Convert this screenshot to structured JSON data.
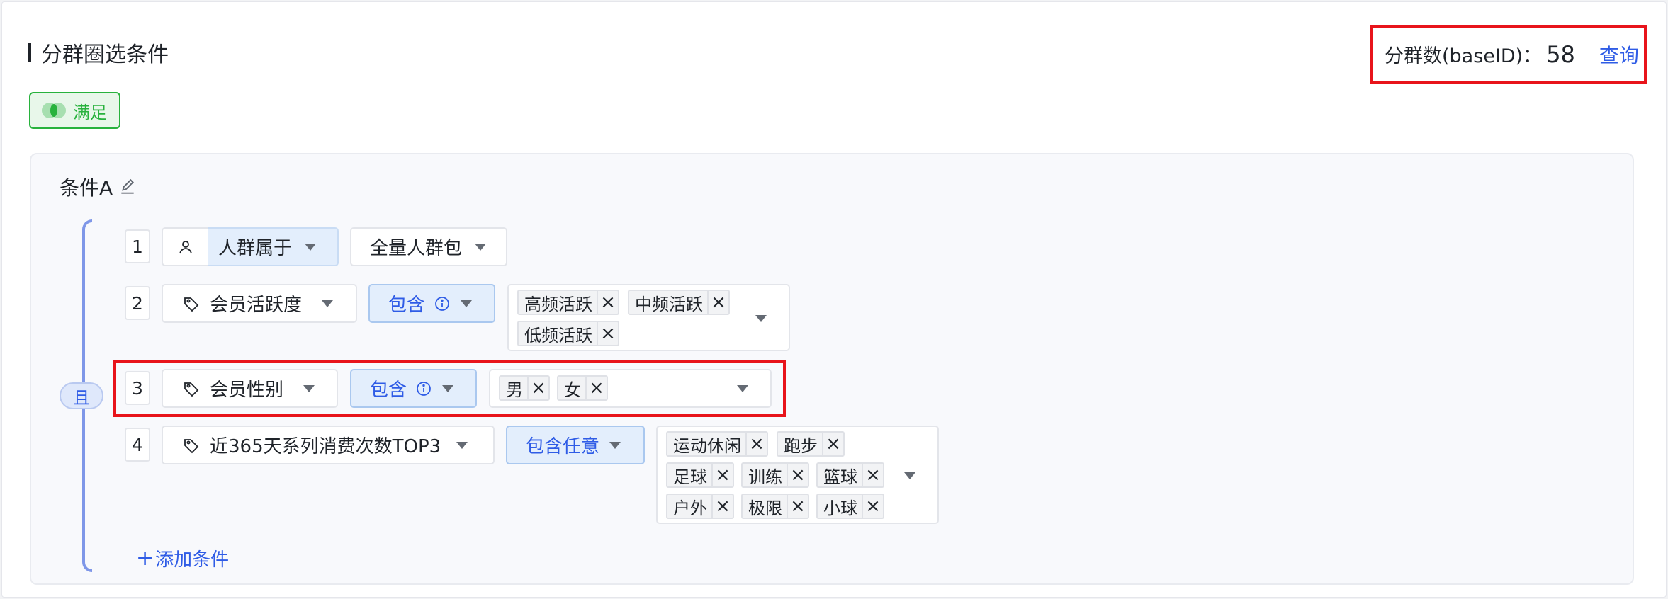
{
  "header": {
    "title": "分群圈选条件",
    "count_label": "分群数(baseID)：",
    "count_value": "58",
    "query_label": "查询"
  },
  "logic_tag": {
    "label": "满足",
    "icon": "venn-intersection-icon",
    "color": "#28b23d"
  },
  "condition": {
    "name": "条件A",
    "logic_label": "且",
    "rows": [
      {
        "num": "1",
        "field": "人群属于",
        "value": "全量人群包",
        "field_icon": "user-icon"
      },
      {
        "num": "2",
        "field": "会员活跃度",
        "operator": "包含",
        "field_icon": "tag-icon",
        "tags": [
          "高频活跃",
          "中频活跃",
          "低频活跃"
        ]
      },
      {
        "num": "3",
        "field": "会员性别",
        "operator": "包含",
        "field_icon": "tag-icon",
        "tags": [
          "男",
          "女"
        ]
      },
      {
        "num": "4",
        "field": "近365天系列消费次数TOP3",
        "operator": "包含任意",
        "field_icon": "tag-icon",
        "tags": [
          "运动休闲",
          "跑步",
          "足球",
          "训练",
          "篮球",
          "户外",
          "极限",
          "小球"
        ]
      }
    ],
    "add_label": "添加条件"
  },
  "colors": {
    "accent": "#2f5ce6",
    "highlight": "#e8141b",
    "success": "#28b23d",
    "bracket": "#7f97e8"
  }
}
